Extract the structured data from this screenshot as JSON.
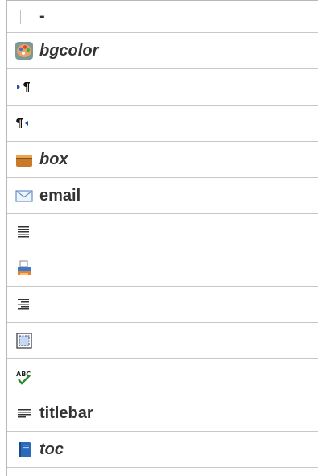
{
  "items": [
    {
      "icon": "separator-icon",
      "label": "-",
      "italic": false
    },
    {
      "icon": "palette-icon",
      "label": "bgcolor",
      "italic": true
    },
    {
      "icon": "ltr-paragraph-icon",
      "label": "",
      "italic": false
    },
    {
      "icon": "rtl-paragraph-icon",
      "label": "",
      "italic": false
    },
    {
      "icon": "box-icon",
      "label": "box",
      "italic": true
    },
    {
      "icon": "envelope-icon",
      "label": "email",
      "italic": false
    },
    {
      "icon": "justify-icon",
      "label": "",
      "italic": false
    },
    {
      "icon": "printer-icon",
      "label": "",
      "italic": false
    },
    {
      "icon": "align-right-icon",
      "label": "",
      "italic": false
    },
    {
      "icon": "select-all-icon",
      "label": "",
      "italic": false
    },
    {
      "icon": "spellcheck-icon",
      "label": "",
      "italic": false
    },
    {
      "icon": "titlebar-icon",
      "label": "titlebar",
      "italic": false
    },
    {
      "icon": "book-icon",
      "label": "toc",
      "italic": true
    }
  ]
}
